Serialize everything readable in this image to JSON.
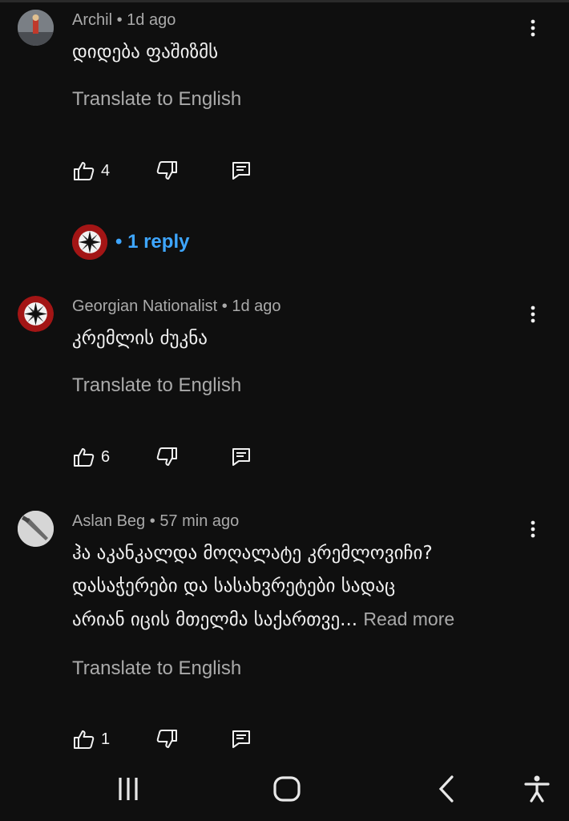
{
  "comments": [
    {
      "author": "Archil",
      "time": "1d ago",
      "text": "დიდება ფაშიზმს",
      "translate_label": "Translate to English",
      "likes": "4"
    },
    {
      "author": "Georgian Nationalist",
      "time": "1d ago",
      "text": "კრემლის ძუკნა",
      "translate_label": "Translate to English",
      "likes": "6"
    },
    {
      "author": "Aslan Beg",
      "time": "57 min ago",
      "text_lines": [
        "ჰა აკანკალდა მოღალატე კრემლოვიჩი?",
        "დასაჭერები და სასახვრეტები სადაც",
        "არიან იცის მთელმა საქართვე..."
      ],
      "read_more": "Read more",
      "translate_label": "Translate to English",
      "likes": "1"
    }
  ],
  "replies": {
    "label": "1 reply"
  },
  "colors": {
    "background": "#0f0f0f",
    "link": "#3ea6ff",
    "secondary_text": "#aaaaaa"
  },
  "icons": [
    "thumb-up-icon",
    "thumb-down-icon",
    "reply-icon",
    "more-vert-icon",
    "recents-icon",
    "home-icon",
    "back-icon",
    "accessibility-icon"
  ]
}
